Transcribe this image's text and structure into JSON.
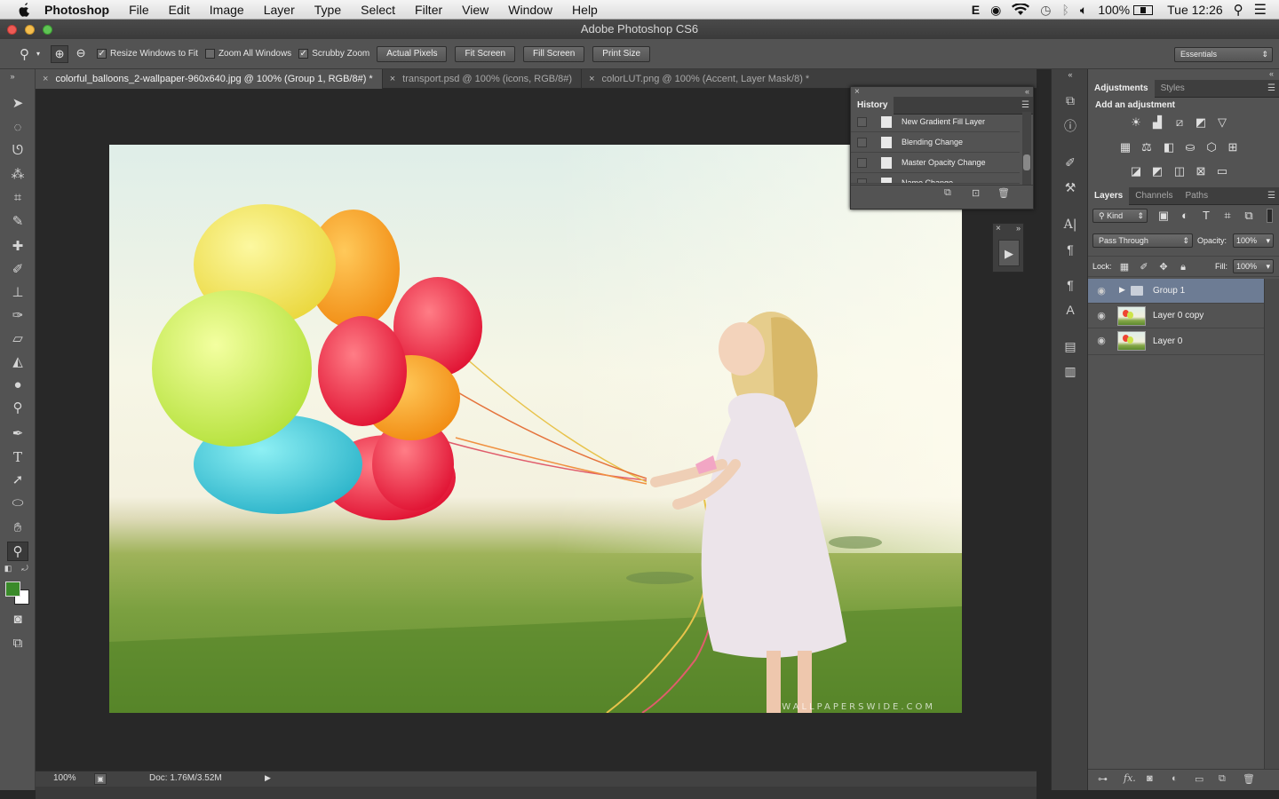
{
  "menubar": {
    "app_name": "Photoshop",
    "items": [
      "File",
      "Edit",
      "Image",
      "Layer",
      "Type",
      "Select",
      "Filter",
      "View",
      "Window",
      "Help"
    ],
    "status_icons": [
      "evernote-icon",
      "wifi-icon",
      "time-machine-icon",
      "bluetooth-icon",
      "volume-icon",
      "battery-icon",
      "spotlight-icon",
      "notification-list-icon"
    ],
    "battery_text": "100%",
    "clock": "Tue 12:26",
    "e_letter": "E"
  },
  "window": {
    "title": "Adobe Photoshop CS6"
  },
  "options_bar": {
    "checkboxes": [
      {
        "label": "Resize Windows to Fit",
        "checked": true
      },
      {
        "label": "Zoom All Windows",
        "checked": false
      },
      {
        "label": "Scrubby Zoom",
        "checked": true
      }
    ],
    "buttons": [
      "Actual Pixels",
      "Fit Screen",
      "Fill Screen",
      "Print Size"
    ],
    "workspace": "Essentials"
  },
  "tabs": [
    {
      "label": "colorful_balloons_2-wallpaper-960x640.jpg @ 100% (Group 1, RGB/8#) *",
      "active": true
    },
    {
      "label": "transport.psd @ 100% (icons, RGB/8#)",
      "active": false
    },
    {
      "label": "colorLUT.png @ 100% (Accent, Layer Mask/8) *",
      "active": false
    }
  ],
  "photo": {
    "watermark": "WALLPAPERSWIDE.COM"
  },
  "status_bar": {
    "zoom": "100%",
    "doc_info": "Doc: 1.76M/3.52M"
  },
  "history": {
    "title": "History",
    "items": [
      "New Gradient Fill Layer",
      "Blending Change",
      "Master Opacity Change",
      "Name Change"
    ]
  },
  "adjustments": {
    "tabs": [
      "Adjustments",
      "Styles"
    ],
    "heading": "Add an adjustment"
  },
  "layers_panel": {
    "tabs": [
      "Layers",
      "Channels",
      "Paths"
    ],
    "kind_label": "Kind",
    "blend_mode": "Pass Through",
    "opacity_label": "Opacity:",
    "opacity_value": "100%",
    "lock_label": "Lock:",
    "fill_label": "Fill:",
    "fill_value": "100%",
    "layers": [
      {
        "name": "Group 1",
        "type": "group",
        "selected": true
      },
      {
        "name": "Layer 0 copy",
        "type": "image",
        "selected": false
      },
      {
        "name": "Layer 0",
        "type": "image",
        "selected": false
      }
    ]
  },
  "colors": {
    "foreground": "#3a8a2a",
    "background": "#ffffff",
    "selected_layer": "#6d7c94",
    "panel_bg": "#535353"
  }
}
